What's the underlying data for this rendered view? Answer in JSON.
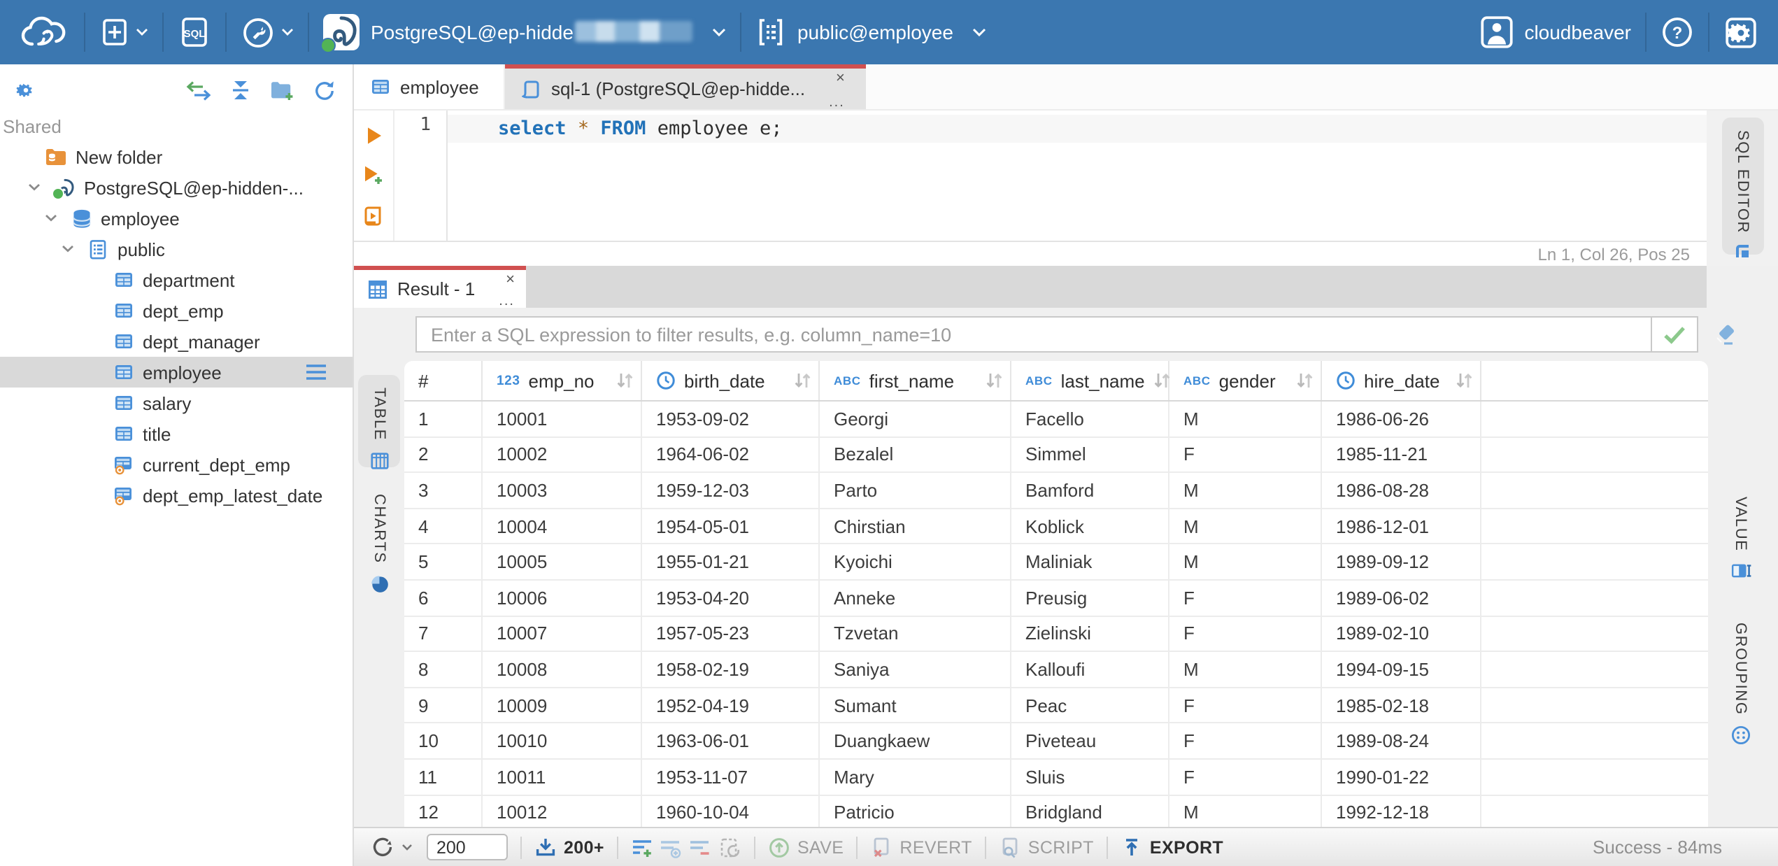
{
  "topbar": {
    "sql_badge": "SQL",
    "connection": {
      "label": "PostgreSQL@ep-hidde",
      "redacted": true
    },
    "schema_selector": {
      "label": "public@employee"
    },
    "user": {
      "name": "cloudbeaver",
      "help": "?"
    }
  },
  "sidebar": {
    "section_label": "Shared",
    "tree": [
      {
        "label": "New folder",
        "icon": "folder-database",
        "level": 1
      },
      {
        "label": "PostgreSQL@ep-hidden-...",
        "icon": "postgres",
        "level": 1,
        "expanded": true
      },
      {
        "label": "employee",
        "icon": "database",
        "level": 2,
        "expanded": true
      },
      {
        "label": "public",
        "icon": "schema",
        "level": 3,
        "expanded": true
      },
      {
        "label": "department",
        "icon": "table",
        "level": 4
      },
      {
        "label": "dept_emp",
        "icon": "table",
        "level": 4
      },
      {
        "label": "dept_manager",
        "icon": "table",
        "level": 4
      },
      {
        "label": "employee",
        "icon": "table",
        "level": 4,
        "selected": true
      },
      {
        "label": "salary",
        "icon": "table",
        "level": 4
      },
      {
        "label": "title",
        "icon": "table",
        "level": 4
      },
      {
        "label": "current_dept_emp",
        "icon": "view",
        "level": 4
      },
      {
        "label": "dept_emp_latest_date",
        "icon": "view",
        "level": 4
      }
    ]
  },
  "doc_tabs": {
    "table_tab": "employee",
    "sql_tab": "sql-1 (PostgreSQL@ep-hidde...",
    "close": "×",
    "overflow": "..."
  },
  "editor": {
    "line_number": "1",
    "tokens": [
      {
        "text": "select",
        "type": "kw"
      },
      {
        "text": " ",
        "type": "pl"
      },
      {
        "text": "*",
        "type": "op"
      },
      {
        "text": " ",
        "type": "pl"
      },
      {
        "text": "FROM",
        "type": "kw"
      },
      {
        "text": " employee e;",
        "type": "pl"
      }
    ],
    "status": "Ln 1, Col 26, Pos 25"
  },
  "side_tabs": {
    "editor": "SQL EDITOR",
    "presentation": [
      "TABLE",
      "CHARTS"
    ],
    "panels": [
      "VALUE",
      "GROUPING"
    ]
  },
  "result": {
    "tab_label": "Result - 1",
    "close": "×",
    "overflow": "...",
    "filter": {
      "placeholder": "Enter a SQL expression to filter results, e.g. column_name=10",
      "value": ""
    },
    "grid": {
      "row_number_header": "#",
      "columns": [
        {
          "name": "emp_no",
          "type": "number"
        },
        {
          "name": "birth_date",
          "type": "datetime"
        },
        {
          "name": "first_name",
          "type": "string"
        },
        {
          "name": "last_name",
          "type": "string"
        },
        {
          "name": "gender",
          "type": "string"
        },
        {
          "name": "hire_date",
          "type": "datetime"
        }
      ],
      "rows": [
        [
          "1",
          "10001",
          "1953-09-02",
          "Georgi",
          "Facello",
          "M",
          "1986-06-26"
        ],
        [
          "2",
          "10002",
          "1964-06-02",
          "Bezalel",
          "Simmel",
          "F",
          "1985-11-21"
        ],
        [
          "3",
          "10003",
          "1959-12-03",
          "Parto",
          "Bamford",
          "M",
          "1986-08-28"
        ],
        [
          "4",
          "10004",
          "1954-05-01",
          "Chirstian",
          "Koblick",
          "M",
          "1986-12-01"
        ],
        [
          "5",
          "10005",
          "1955-01-21",
          "Kyoichi",
          "Maliniak",
          "M",
          "1989-09-12"
        ],
        [
          "6",
          "10006",
          "1953-04-20",
          "Anneke",
          "Preusig",
          "F",
          "1989-06-02"
        ],
        [
          "7",
          "10007",
          "1957-05-23",
          "Tzvetan",
          "Zielinski",
          "F",
          "1989-02-10"
        ],
        [
          "8",
          "10008",
          "1958-02-19",
          "Saniya",
          "Kalloufi",
          "M",
          "1994-09-15"
        ],
        [
          "9",
          "10009",
          "1952-04-19",
          "Sumant",
          "Peac",
          "F",
          "1985-02-18"
        ],
        [
          "10",
          "10010",
          "1963-06-01",
          "Duangkaew",
          "Piveteau",
          "F",
          "1989-08-24"
        ],
        [
          "11",
          "10011",
          "1953-11-07",
          "Mary",
          "Sluis",
          "F",
          "1990-01-22"
        ],
        [
          "12",
          "10012",
          "1960-10-04",
          "Patricio",
          "Bridgland",
          "M",
          "1992-12-18"
        ]
      ]
    },
    "toolbar": {
      "fetch_size": "200",
      "fetch_more_label": "200+",
      "save_label": "SAVE",
      "revert_label": "REVERT",
      "script_label": "SCRIPT",
      "export_label": "EXPORT",
      "status": "Success - 84ms"
    }
  },
  "colors": {
    "topbar_blue": "#3b77b0",
    "accent_red": "#d05050",
    "icon_blue": "#4a90d9",
    "selection_gray": "#d9d9d9"
  }
}
